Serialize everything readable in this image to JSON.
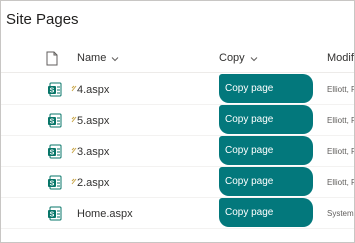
{
  "title": "Site Pages",
  "columns": {
    "name": "Name",
    "copy": "Copy",
    "modified": "Modif"
  },
  "rows": [
    {
      "name": "4.aspx",
      "copy_label": "Copy page",
      "modified_by": "Elliott, F",
      "is_new": true
    },
    {
      "name": "5.aspx",
      "copy_label": "Copy page",
      "modified_by": "Elliott, F",
      "is_new": true
    },
    {
      "name": "3.aspx",
      "copy_label": "Copy page",
      "modified_by": "Elliott, F",
      "is_new": true
    },
    {
      "name": "2.aspx",
      "copy_label": "Copy page",
      "modified_by": "Elliott, F",
      "is_new": true
    },
    {
      "name": "Home.aspx",
      "copy_label": "Copy page",
      "modified_by": "System",
      "is_new": false
    }
  ],
  "colors": {
    "accent": "#03787c",
    "file_icon": "#077568",
    "new_mark": "#c8a444"
  },
  "icons": {
    "filetype_header": "document-icon",
    "file": "sharepoint-page-icon",
    "new": "new-item-icon",
    "sort": "chevron-down-icon"
  }
}
